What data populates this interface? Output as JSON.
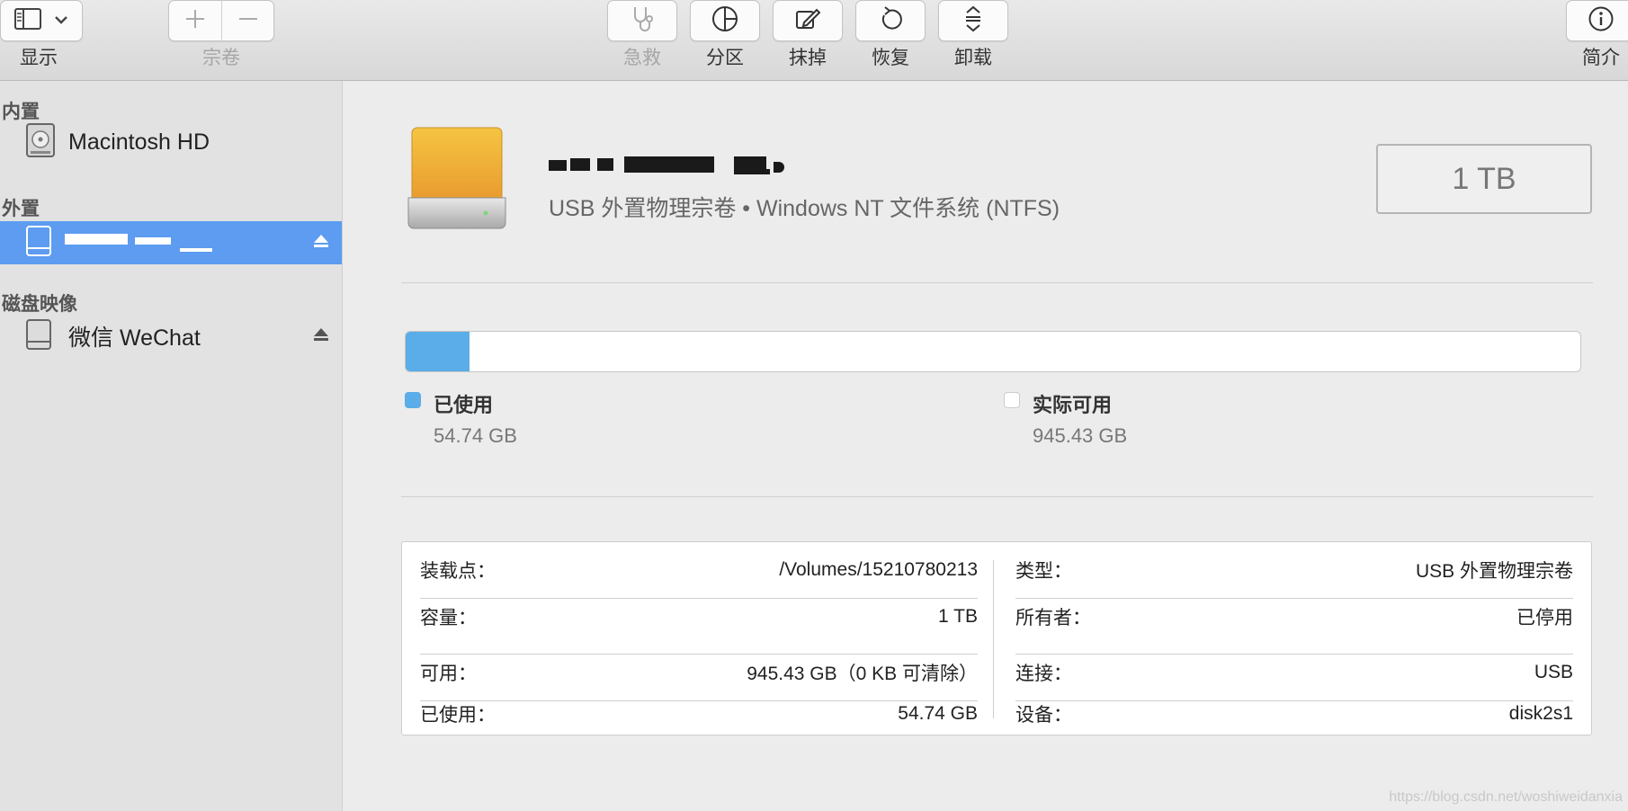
{
  "toolbar": {
    "view_label": "显示",
    "volume_label": "宗卷",
    "first_aid_label": "急救",
    "partition_label": "分区",
    "erase_label": "抹掉",
    "restore_label": "恢复",
    "unmount_label": "卸载",
    "info_label": "简介"
  },
  "sidebar": {
    "sections": {
      "internal": "内置",
      "external": "外置",
      "disk_images": "磁盘映像"
    },
    "items": [
      {
        "label": "Macintosh HD"
      },
      {
        "label": ""
      },
      {
        "label": "微信 WeChat"
      }
    ]
  },
  "disk": {
    "subtitle": "USB 外置物理宗卷 • Windows NT 文件系统 (NTFS)",
    "capacity_badge": "1 TB"
  },
  "usage": {
    "used_fraction": 0.0547,
    "used_title": "已使用",
    "used_value": "54.74 GB",
    "free_title": "实际可用",
    "free_value": "945.43 GB",
    "used_color": "#5aade8",
    "free_color": "#ffffff"
  },
  "info": {
    "left": [
      {
        "key": "装载点：",
        "value": "/Volumes/15210780213"
      },
      {
        "key": "容量：",
        "value": "1 TB"
      },
      {
        "key": "可用：",
        "value": "945.43 GB（0 KB 可清除）"
      },
      {
        "key": "已使用：",
        "value": "54.74 GB"
      }
    ],
    "right": [
      {
        "key": "类型：",
        "value": "USB 外置物理宗卷"
      },
      {
        "key": "所有者：",
        "value": "已停用"
      },
      {
        "key": "连接：",
        "value": "USB"
      },
      {
        "key": "设备：",
        "value": "disk2s1"
      }
    ]
  },
  "watermark": "https://blog.csdn.net/woshiweidanxia"
}
